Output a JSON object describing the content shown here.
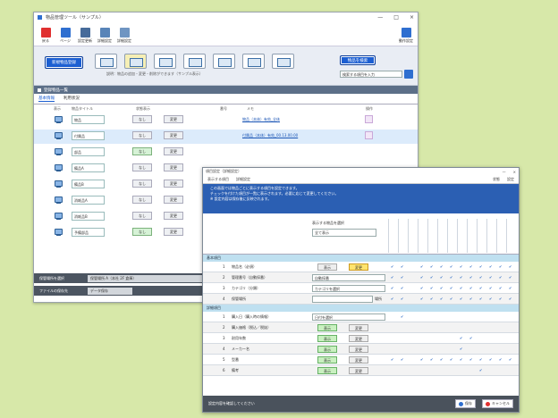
{
  "main": {
    "title": "物品管理ツール（サンプル）",
    "controls": [
      "—",
      "□",
      "×"
    ],
    "toolbar": [
      "戻る",
      "ページ",
      "設定更新",
      "詳細設定",
      "詳細設定"
    ],
    "toolbar_right": "動作設定",
    "ribbon": {
      "left_button": "新規物品登録",
      "right_button": "物品を検索",
      "search_value": "検索する項目を入力",
      "hint": "説明：物品の追加・変更・削除ができます（サンプル表示）"
    },
    "section_title": "登録物品一覧",
    "tabs": [
      "基本情報",
      "利用状況"
    ],
    "columns": [
      "表示",
      "物品タイトル",
      "状態表示",
      "番号",
      "メモ",
      "操作"
    ],
    "rows": [
      {
        "name": "物品",
        "status": "なし",
        "action": "変更",
        "link": "物品（本体）有効_全体"
      },
      {
        "name": "付属品",
        "status": "なし",
        "action": "変更",
        "link": "付属品（本体）有効_00.13.00.00"
      },
      {
        "name": "部品",
        "status": "なし",
        "action": "変更",
        "link": ""
      },
      {
        "name": "備品A",
        "status": "なし",
        "action": "変更",
        "link": ""
      },
      {
        "name": "備品B",
        "status": "なし",
        "action": "変更",
        "link": ""
      },
      {
        "name": "消耗品A",
        "status": "なし",
        "action": "変更",
        "link": ""
      },
      {
        "name": "消耗品B",
        "status": "なし",
        "action": "変更",
        "link": ""
      },
      {
        "name": "予備部品",
        "status": "なし",
        "action": "変更",
        "link": ""
      }
    ],
    "footer": [
      {
        "label": "保管場所を選択",
        "value": "保管場所 A（本社 2F 倉庫）"
      },
      {
        "label": "ファイルの保存先",
        "value": "データ保存"
      }
    ]
  },
  "dialog": {
    "title": "項目設定（詳細設定）",
    "toolbar": [
      "表示する項目",
      "詳細設定",
      "状態",
      "設定"
    ],
    "banner": [
      "この画面では物品ごとに表示する項目を設定できます。",
      "チェックを付けた項目が一覧に表示されます。必要に応じて変更してください。",
      "※ 設定内容は保存後に反映されます。"
    ],
    "filter_label": "表示する物品を選択",
    "filter_value": "全て表示",
    "groups": [
      {
        "title": "基本項目",
        "rows": [
          {
            "num": "1",
            "name": "物品名（必須）",
            "btn1": "表示",
            "btn2": "変更",
            "type": "btnpair",
            "checks": [
              1,
              1,
              0,
              1,
              1,
              1,
              1,
              1,
              1,
              1,
              1,
              1,
              1
            ]
          },
          {
            "num": "2",
            "name": "管理番号（自動採番）",
            "value": "自動採番",
            "type": "dropdown",
            "checks": [
              1,
              1,
              0,
              1,
              1,
              1,
              1,
              1,
              1,
              1,
              1,
              1,
              1
            ]
          },
          {
            "num": "3",
            "name": "カテゴリ（分類）",
            "value": "カテゴリを選択",
            "type": "dropdown",
            "checks": [
              1,
              1,
              0,
              1,
              1,
              1,
              1,
              1,
              1,
              1,
              1,
              1,
              1
            ]
          },
          {
            "num": "4",
            "name": "保管場所",
            "value": "",
            "type": "dropdown",
            "extra": "場所",
            "checks": [
              1,
              1,
              0,
              1,
              1,
              1,
              1,
              1,
              1,
              1,
              1,
              1,
              1
            ]
          }
        ]
      },
      {
        "title": "詳細項目",
        "rows": [
          {
            "num": "1",
            "name": "購入日（購入時の情報）",
            "value": "日付を選択",
            "type": "dropdown",
            "checks": [
              0,
              1,
              0,
              0,
              0,
              0,
              0,
              0,
              0,
              0,
              0,
              0,
              0
            ]
          },
          {
            "num": "2",
            "name": "購入価格（税込／税抜）",
            "btn1": "表示",
            "btn2": "変更",
            "type": "btnpair2",
            "checks": [
              0,
              0,
              0,
              0,
              0,
              0,
              0,
              0,
              0,
              0,
              0,
              0,
              0
            ]
          },
          {
            "num": "3",
            "name": "耐用年数",
            "btn1": "表示",
            "btn2": "変更",
            "type": "btnpair2",
            "checks": [
              0,
              0,
              0,
              0,
              0,
              0,
              0,
              1,
              1,
              0,
              0,
              0,
              0
            ]
          },
          {
            "num": "4",
            "name": "メーカー名",
            "btn1": "表示",
            "btn2": "変更",
            "type": "btnpair2",
            "checks": [
              0,
              0,
              0,
              0,
              0,
              0,
              0,
              1,
              0,
              0,
              0,
              0,
              0
            ]
          },
          {
            "num": "5",
            "name": "型番",
            "btn1": "表示",
            "btn2": "変更",
            "type": "btnpair2",
            "checks": [
              1,
              1,
              0,
              1,
              1,
              1,
              1,
              1,
              1,
              1,
              1,
              1,
              1
            ]
          },
          {
            "num": "6",
            "name": "備考",
            "btn1": "表示",
            "btn2": "変更",
            "type": "btnpair2",
            "checks": [
              0,
              0,
              0,
              0,
              0,
              0,
              0,
              0,
              0,
              1,
              0,
              0,
              0
            ]
          }
        ]
      }
    ],
    "footer_text": "設定内容を確認してください",
    "ok_label": "保存",
    "cancel_label": "キャンセル"
  }
}
